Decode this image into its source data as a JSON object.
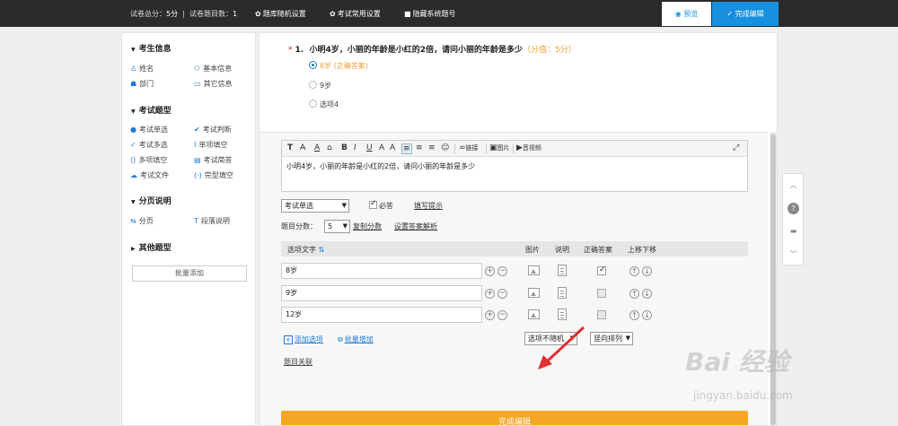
{
  "topbar": {
    "total_label": "试卷总分：",
    "total_value": "5分",
    "sep": "|",
    "count_label": "试卷题目数：",
    "count_value": "1",
    "menu_random": "题库随机设置",
    "menu_common": "考试常用设置",
    "menu_hide": "隐藏系统题号",
    "preview": "预览",
    "finish": "完成编辑"
  },
  "sidebar": {
    "sec1": "考生信息",
    "sec1_items": [
      "姓名",
      "基本信息",
      "部门",
      "其它信息"
    ],
    "sec2": "考试题型",
    "sec2_items": [
      "考试单选",
      "考试判断",
      "考试多选",
      "单项填空",
      "多项填空",
      "考试简答",
      "考试文件",
      "完型填空"
    ],
    "sec3": "分页说明",
    "sec3_items": [
      "分页",
      "段落说明"
    ],
    "sec4": "其他题型",
    "batch_add": "批量添加"
  },
  "question": {
    "required_mark": "*",
    "number": "1.",
    "text": "小明4岁，小丽的年龄是小红的2倍，请问小丽的年龄是多少",
    "score": "（分值：5分）",
    "options": [
      "8岁 (正确答案)",
      "9岁",
      "选项4"
    ]
  },
  "editor": {
    "content": "小明4岁，小丽的年龄是小红的2倍，请问小丽的年龄是多少",
    "tb_link": "链接",
    "tb_image": "图片",
    "tb_video": "音视频"
  },
  "settings": {
    "type_select": "考试单选",
    "required_label": "必答",
    "fill_hint": "填写提示",
    "score_label": "题目分数：",
    "score_value": "5",
    "copy_score": "复制分数",
    "set_analysis": "设置答案解析"
  },
  "options_table": {
    "headers": [
      "选项文字",
      "图片",
      "说明",
      "正确答案",
      "上移下移"
    ],
    "sort_icon": "⇅",
    "rows": [
      {
        "text": "8岁",
        "correct": true
      },
      {
        "text": "9岁",
        "correct": false
      },
      {
        "text": "12岁",
        "correct": false
      }
    ],
    "add_option": "添加选项",
    "batch_add": "批量增加",
    "random_select": "选项不随机",
    "layout_select": "竖向排列",
    "relation": "题目关联"
  },
  "finish_bottom": "完成编辑",
  "watermark": {
    "brand": "Bai 经验",
    "url": "jingyan.baidu.com"
  },
  "colors": {
    "topbar": "#2b2b2b",
    "accent_blue": "#1890e0",
    "finish_orange": "#f5a623",
    "score_orange": "#e8a23a",
    "arrow_red": "#e03030"
  }
}
